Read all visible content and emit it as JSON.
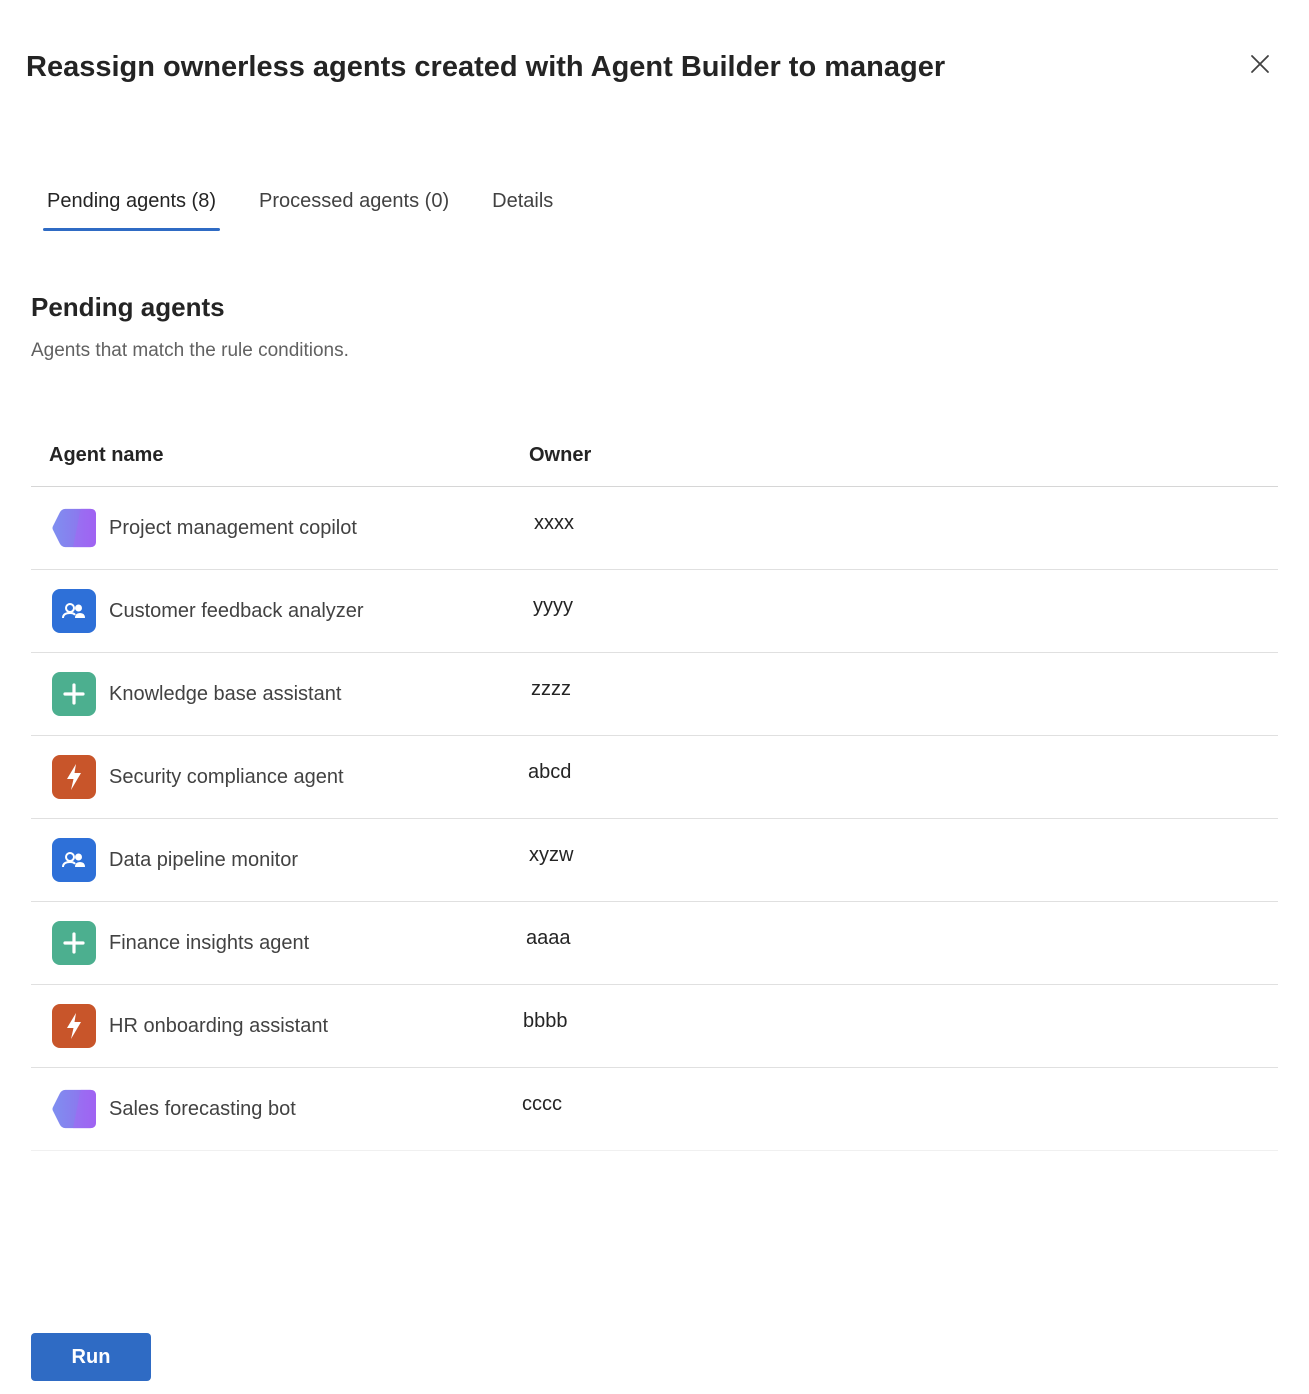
{
  "dialog": {
    "title": "Reassign ownerless agents created with Agent Builder to manager",
    "close_icon": "close-icon"
  },
  "tabs": [
    {
      "label": "Pending agents (8)",
      "active": true
    },
    {
      "label": "Processed agents (0)",
      "active": false
    },
    {
      "label": "Details",
      "active": false
    }
  ],
  "section": {
    "title": "Pending agents",
    "subtitle": "Agents that match the rule conditions."
  },
  "table": {
    "headers": {
      "name": "Agent name",
      "owner": "Owner"
    },
    "rows": [
      {
        "name": "Project management copilot",
        "owner": "xxxx",
        "icon": "copilot-gradient-icon"
      },
      {
        "name": "Customer feedback analyzer",
        "owner": "yyyy",
        "icon": "people-chat-icon"
      },
      {
        "name": "Knowledge base assistant",
        "owner": "zzzz",
        "icon": "plus-icon"
      },
      {
        "name": "Security compliance agent",
        "owner": "abcd",
        "icon": "lightning-icon"
      },
      {
        "name": "Data pipeline monitor",
        "owner": "xyzw",
        "icon": "people-chat-icon"
      },
      {
        "name": "Finance insights agent",
        "owner": "aaaa",
        "icon": "plus-icon"
      },
      {
        "name": "HR onboarding assistant",
        "owner": "bbbb",
        "icon": "lightning-icon"
      },
      {
        "name": "Sales forecasting bot",
        "owner": "cccc",
        "icon": "copilot-gradient-icon"
      }
    ]
  },
  "footer": {
    "run_label": "Run"
  },
  "colors": {
    "accent": "#2f6bc4",
    "icon_blue": "#2e70d8",
    "icon_green": "#4caf8f",
    "icon_orange": "#c8552a"
  }
}
